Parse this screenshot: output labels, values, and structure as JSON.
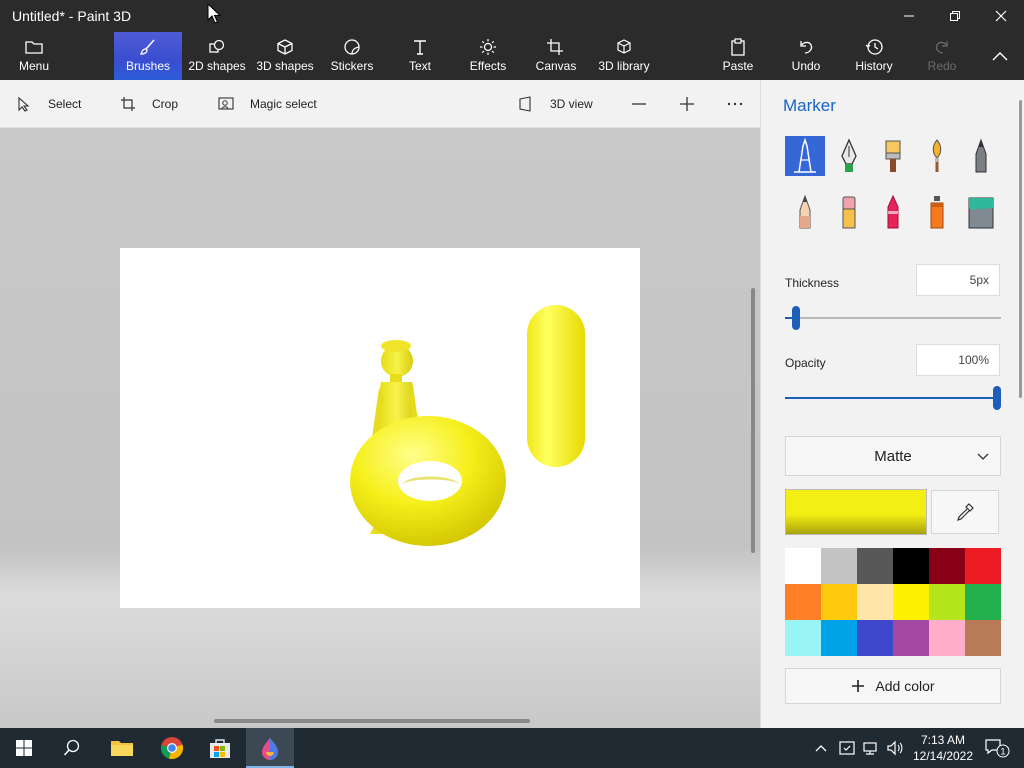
{
  "window": {
    "title": "Untitled* - Paint 3D"
  },
  "ribbon": {
    "menu": "Menu",
    "tools": [
      {
        "label": "Brushes",
        "icon": "brush-icon",
        "active": true
      },
      {
        "label": "2D shapes",
        "icon": "2d-shapes-icon"
      },
      {
        "label": "3D shapes",
        "icon": "3d-shapes-icon"
      },
      {
        "label": "Stickers",
        "icon": "stickers-icon"
      },
      {
        "label": "Text",
        "icon": "text-icon"
      },
      {
        "label": "Effects",
        "icon": "effects-icon"
      },
      {
        "label": "Canvas",
        "icon": "canvas-icon"
      },
      {
        "label": "3D library",
        "icon": "3d-library-icon"
      }
    ],
    "paste": "Paste",
    "undo": "Undo",
    "history": "History",
    "redo": "Redo"
  },
  "toolbar": {
    "select": "Select",
    "crop": "Crop",
    "magic_select": "Magic select",
    "view_3d": "3D view"
  },
  "panel": {
    "title": "Marker",
    "brushes": [
      "marker",
      "calligraphy-pen",
      "oil-brush",
      "watercolor",
      "pixel-pen",
      "pencil",
      "eraser",
      "crayon",
      "spray-can",
      "fill"
    ],
    "thickness_label": "Thickness",
    "thickness_value": "5px",
    "thickness_level": 0.05,
    "opacity_label": "Opacity",
    "opacity_value": "100%",
    "opacity_level": 1.0,
    "finish": "Matte",
    "current_color": "#f3ef14",
    "palette": [
      "#ffffff",
      "#c3c3c3",
      "#585858",
      "#000000",
      "#880015",
      "#ed1c24",
      "#ff7f27",
      "#ffc90e",
      "#ffe5a8",
      "#fff200",
      "#b5e61d",
      "#22b14c",
      "#99f5f5",
      "#00a2e8",
      "#3f48cc",
      "#a349a4",
      "#ffaec9",
      "#b97a57"
    ],
    "add_color": "Add color"
  },
  "taskbar": {
    "time": "7:13 AM",
    "date": "12/14/2022",
    "notifications": "1"
  }
}
